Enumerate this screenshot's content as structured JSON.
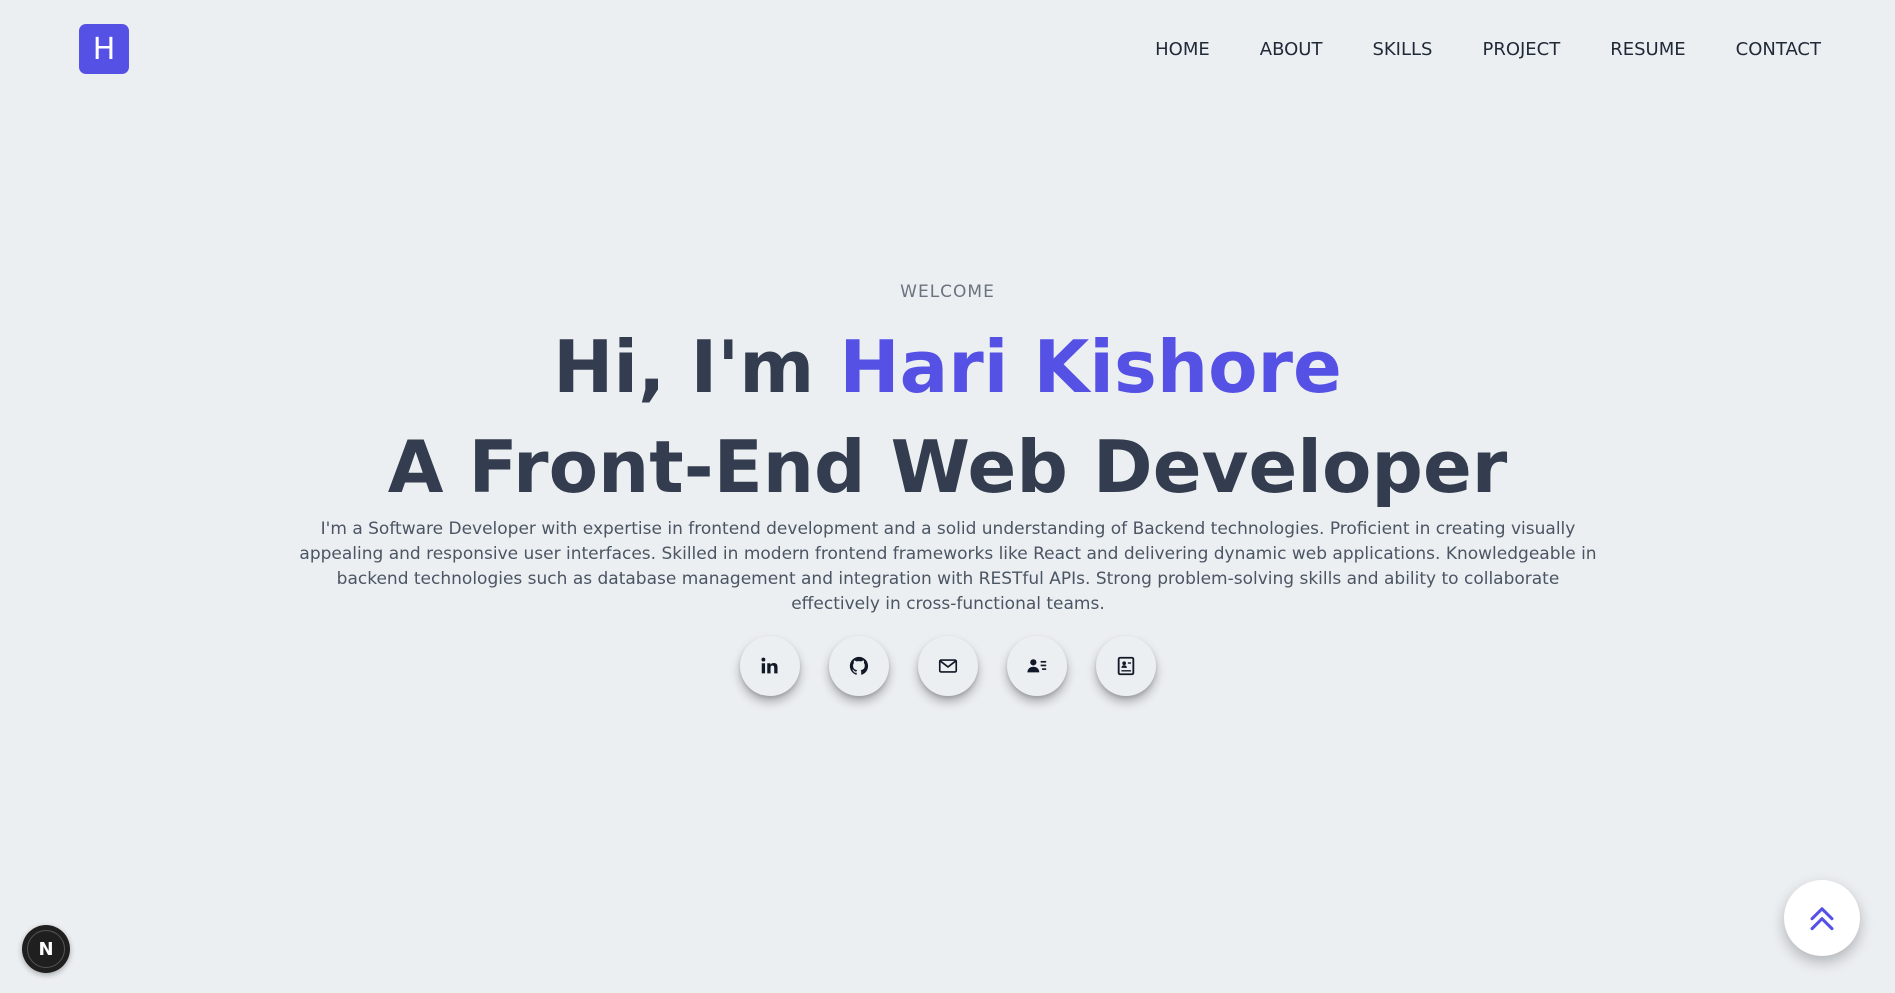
{
  "header": {
    "logo_letter": "H",
    "nav": [
      {
        "label": "HOME"
      },
      {
        "label": "ABOUT"
      },
      {
        "label": "SKILLS"
      },
      {
        "label": "PROJECT"
      },
      {
        "label": "RESUME"
      },
      {
        "label": "CONTACT"
      }
    ]
  },
  "hero": {
    "eyebrow": "WELCOME",
    "greeting": "Hi, I'm ",
    "name": "Hari Kishore",
    "role": "A Front-End Web Developer",
    "bio": "I'm a Software Developer with expertise in frontend development and a solid understanding of Backend technologies. Proficient in creating visually appealing and responsive user interfaces. Skilled in modern frontend frameworks like React and delivering dynamic web applications. Knowledgeable in backend technologies such as database management and integration with RESTful APIs. Strong problem-solving skills and ability to collaborate effectively in cross-functional teams."
  },
  "socials": [
    {
      "icon": "linkedin-icon"
    },
    {
      "icon": "github-icon"
    },
    {
      "icon": "mail-icon"
    },
    {
      "icon": "contact-card-icon"
    },
    {
      "icon": "resume-icon"
    }
  ],
  "floating": {
    "next_badge_letter": "N",
    "scroll_top_icon": "double-chevron-up-icon"
  },
  "colors": {
    "background": "#eceff2",
    "accent": "#5651e5",
    "heading": "#333d4f",
    "body_text": "#4b5563"
  }
}
